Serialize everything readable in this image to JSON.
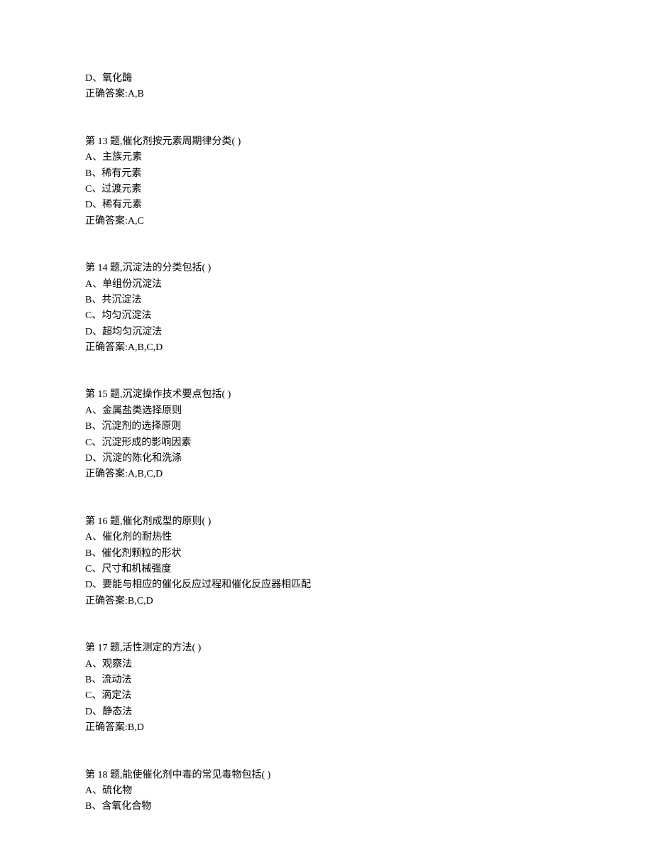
{
  "prelude": {
    "optionD": "D、氧化酶",
    "answer": "正确答案:A,B"
  },
  "questions": [
    {
      "header": "第 13 题,催化剂按元素周期律分类( )",
      "options": [
        "A、主族元素",
        "B、稀有元素",
        "C、过渡元素",
        "D、稀有元素"
      ],
      "answer": "正确答案:A,C"
    },
    {
      "header": "第 14 题,沉淀法的分类包括( )",
      "options": [
        "A、单组份沉淀法",
        "B、共沉淀法",
        "C、均匀沉淀法",
        "D、超均匀沉淀法"
      ],
      "answer": "正确答案:A,B,C,D"
    },
    {
      "header": "第 15 题,沉淀操作技术要点包括( )",
      "options": [
        "A、金属盐类选择原则",
        "B、沉淀剂的选择原则",
        "C、沉淀形成的影响因素",
        "D、沉淀的陈化和洗涤"
      ],
      "answer": "正确答案:A,B,C,D"
    },
    {
      "header": "第 16 题,催化剂成型的原则( )",
      "options": [
        "A、催化剂的耐热性",
        "B、催化剂颗粒的形状",
        "C、尺寸和机械强度",
        "D、要能与相应的催化反应过程和催化反应器相匹配"
      ],
      "answer": "正确答案:B,C,D"
    },
    {
      "header": "第 17 题,活性测定的方法( )",
      "options": [
        "A、观察法",
        "B、流动法",
        "C、滴定法",
        "D、静态法"
      ],
      "answer": "正确答案:B,D"
    },
    {
      "header": "第 18 题,能使催化剂中毒的常见毒物包括( )",
      "options": [
        "A、硫化物",
        "B、含氧化合物"
      ],
      "answer": ""
    }
  ]
}
